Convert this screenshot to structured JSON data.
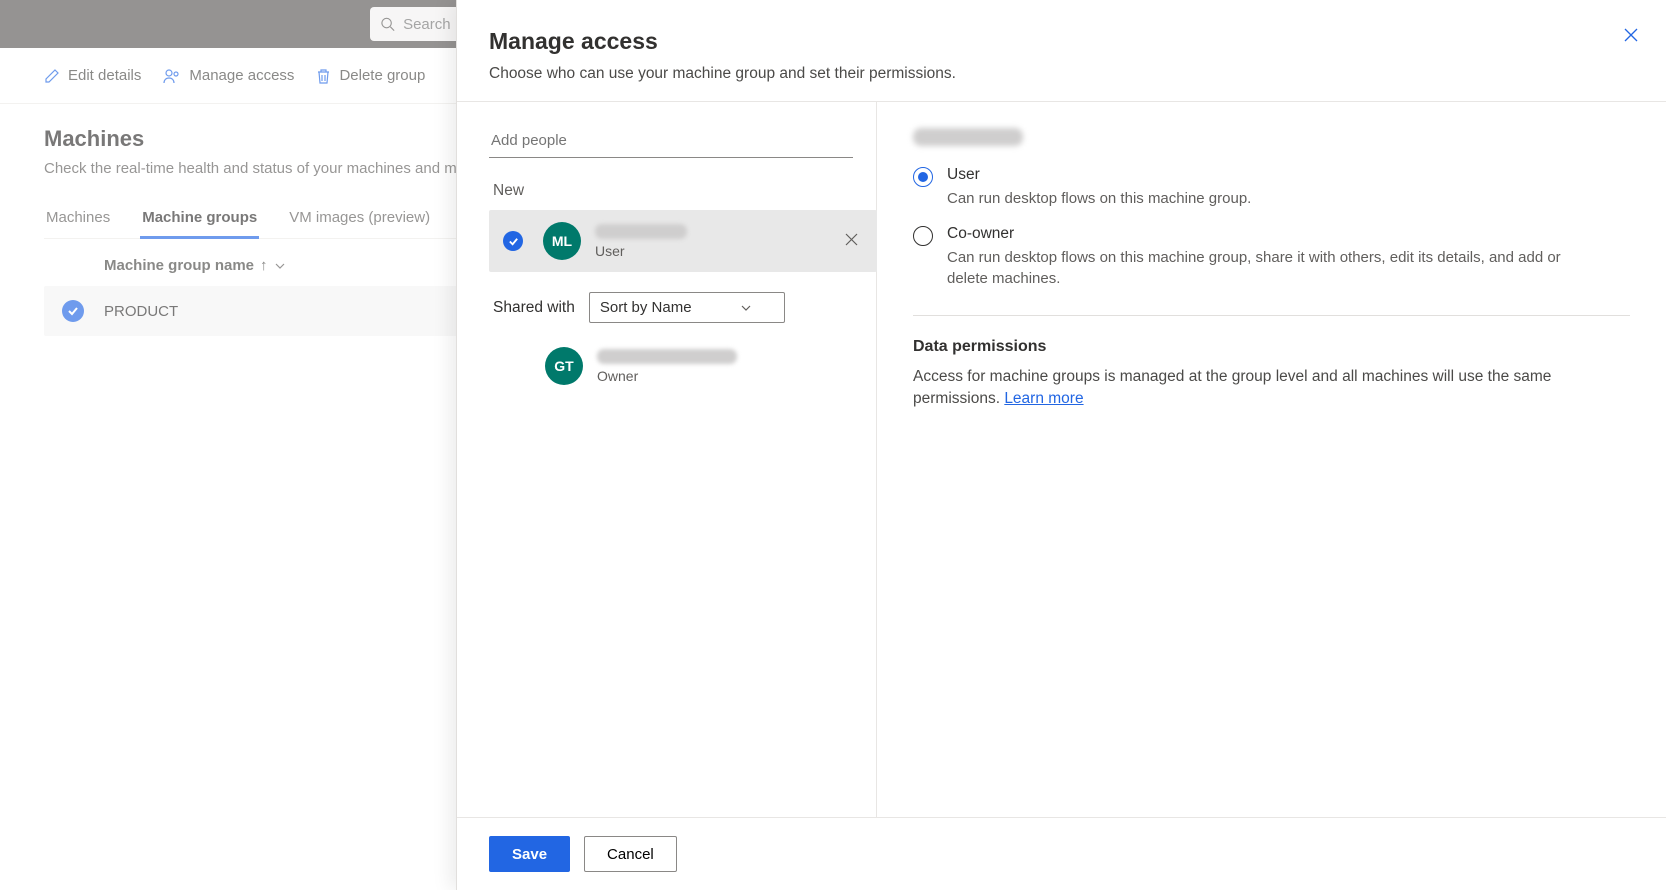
{
  "topbar": {
    "search_placeholder": "Search"
  },
  "cmdbar": {
    "edit": "Edit details",
    "manage": "Manage access",
    "delete": "Delete group"
  },
  "page": {
    "title": "Machines",
    "subtitle": "Check the real-time health and status of your machines and machine groups."
  },
  "tabs": [
    "Machines",
    "Machine groups",
    "VM images (preview)"
  ],
  "active_tab": "Machine groups",
  "table": {
    "col1": "Machine group name",
    "rows": [
      {
        "name": "PRODUCT"
      }
    ]
  },
  "panel": {
    "title": "Manage access",
    "subtitle": "Choose who can use your machine group and set their permissions.",
    "add_placeholder": "Add people",
    "new_label": "New",
    "shared_label": "Shared with",
    "sort_value": "Sort by Name",
    "people_new": [
      {
        "initials": "ML",
        "role": "User",
        "selected": true
      }
    ],
    "people_shared": [
      {
        "initials": "GT",
        "role": "Owner"
      }
    ],
    "roles": {
      "user": {
        "label": "User",
        "desc": "Can run desktop flows on this machine group."
      },
      "coowner": {
        "label": "Co-owner",
        "desc": "Can run desktop flows on this machine group, share it with others, edit its details, and add or delete machines."
      }
    },
    "selected_role": "user",
    "data_perm": {
      "title": "Data permissions",
      "text": "Access for machine groups is managed at the group level and all machines will use the same permissions. ",
      "link": "Learn more"
    },
    "save": "Save",
    "cancel": "Cancel"
  }
}
